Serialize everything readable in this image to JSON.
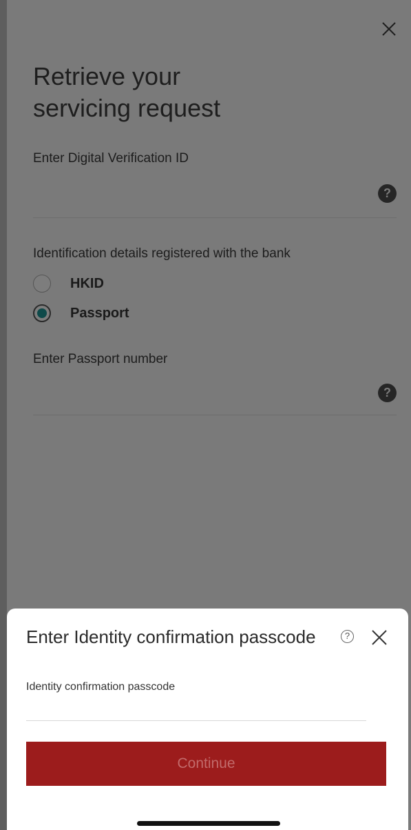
{
  "background": {
    "title": "Retrieve your\nservicing request",
    "verification_id_label": "Enter Digital Verification ID",
    "id_details_label": "Identification details registered with the bank",
    "id_options": [
      {
        "label": "HKID",
        "selected": false
      },
      {
        "label": "Passport",
        "selected": true
      }
    ],
    "passport_label": "Enter Passport number",
    "help_glyph": "?",
    "close_icon": "close-icon"
  },
  "sheet": {
    "title": "Enter Identity confirmation passcode",
    "help_glyph": "?",
    "input_label": "Identity confirmation passcode",
    "input_value": "",
    "continue_label": "Continue"
  },
  "colors": {
    "overlay": "#7a7a7a",
    "primary_button": "#9c1c1c",
    "radio_selected": "#0e4a4a"
  }
}
